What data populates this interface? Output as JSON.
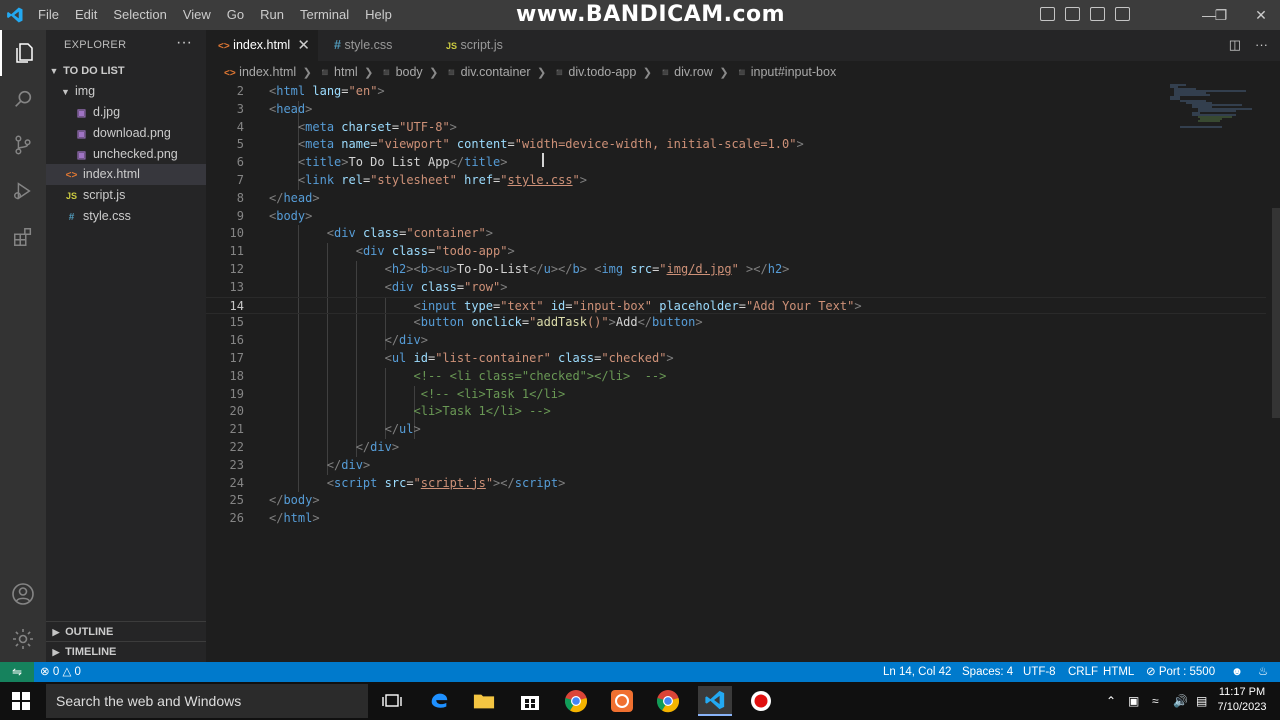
{
  "titlebar": {
    "menu": [
      "File",
      "Edit",
      "Selection",
      "View",
      "Go",
      "Run",
      "Terminal",
      "Help"
    ],
    "watermark": "www.BANDICAM.com"
  },
  "activity_bar": {
    "icons": [
      "explorer-icon",
      "search-icon",
      "source-control-icon",
      "run-debug-icon",
      "extensions-icon",
      "account-icon",
      "settings-gear-icon"
    ]
  },
  "sidebar": {
    "header": "EXPLORER",
    "more": "···",
    "root": "TO DO LIST",
    "tree": [
      {
        "label": "img",
        "kind": "folder"
      },
      {
        "label": "d.jpg",
        "kind": "image"
      },
      {
        "label": "download.png",
        "kind": "image"
      },
      {
        "label": "unchecked.png",
        "kind": "image"
      },
      {
        "label": "index.html",
        "kind": "html"
      },
      {
        "label": "script.js",
        "kind": "js"
      },
      {
        "label": "style.css",
        "kind": "css"
      }
    ],
    "outline": "OUTLINE",
    "timeline": "TIMELINE"
  },
  "tabs": [
    {
      "label": "index.html",
      "icon": "<>",
      "active": true
    },
    {
      "label": "style.css",
      "icon": "#",
      "active": false
    },
    {
      "label": "script.js",
      "icon": "JS",
      "active": false
    }
  ],
  "breadcrumb": [
    "index.html",
    "html",
    "body",
    "div.container",
    "div.todo-app",
    "div.row",
    "input#input-box"
  ],
  "editor": {
    "current_line": 14,
    "lines": [
      {
        "n": "2",
        "html": "<span class=\"br\">&lt;</span><span class=\"t\">html</span> <span class=\"a\">lang</span>=<span class=\"s\">\"en\"</span><span class=\"br\">&gt;</span>"
      },
      {
        "n": "3",
        "html": "<span class=\"br\">&lt;</span><span class=\"t\">head</span><span class=\"br\">&gt;</span>"
      },
      {
        "n": "4",
        "html": "    <span class=\"br\">&lt;</span><span class=\"t\">meta</span> <span class=\"a\">charset</span>=<span class=\"s\">\"UTF-8\"</span><span class=\"br\">&gt;</span>"
      },
      {
        "n": "5",
        "html": "    <span class=\"br\">&lt;</span><span class=\"t\">meta</span> <span class=\"a\">name</span>=<span class=\"s\">\"viewport\"</span> <span class=\"a\">content</span>=<span class=\"s\">\"width=device-width, initial-scale=1.0\"</span><span class=\"br\">&gt;</span>"
      },
      {
        "n": "6",
        "html": "    <span class=\"br\">&lt;</span><span class=\"t\">title</span><span class=\"br\">&gt;</span><span class=\"tx\">To Do List App</span><span class=\"br\">&lt;/</span><span class=\"t\">title</span><span class=\"br\">&gt;</span>"
      },
      {
        "n": "7",
        "html": "    <span class=\"br\">&lt;</span><span class=\"t\">link</span> <span class=\"a\">rel</span>=<span class=\"s\">\"stylesheet\"</span> <span class=\"a\">href</span>=<span class=\"s\">\"<u>style.css</u>\"</span><span class=\"br\">&gt;</span>"
      },
      {
        "n": "8",
        "html": "<span class=\"br\">&lt;/</span><span class=\"t\">head</span><span class=\"br\">&gt;</span>"
      },
      {
        "n": "9",
        "html": "<span class=\"br\">&lt;</span><span class=\"t\">body</span><span class=\"br\">&gt;</span>"
      },
      {
        "n": "10",
        "html": "        <span class=\"br\">&lt;</span><span class=\"t\">div</span> <span class=\"a\">class</span>=<span class=\"s\">\"container\"</span><span class=\"br\">&gt;</span>"
      },
      {
        "n": "11",
        "html": "            <span class=\"br\">&lt;</span><span class=\"t\">div</span> <span class=\"a\">class</span>=<span class=\"s\">\"todo-app\"</span><span class=\"br\">&gt;</span>"
      },
      {
        "n": "12",
        "html": "                <span class=\"br\">&lt;</span><span class=\"t\">h2</span><span class=\"br\">&gt;&lt;</span><span class=\"t\">b</span><span class=\"br\">&gt;&lt;</span><span class=\"t\">u</span><span class=\"br\">&gt;</span><span class=\"tx\">To-Do-List</span><span class=\"br\">&lt;/</span><span class=\"t\">u</span><span class=\"br\">&gt;&lt;/</span><span class=\"t\">b</span><span class=\"br\">&gt;</span> <span class=\"br\">&lt;</span><span class=\"t\">img</span> <span class=\"a\">src</span>=<span class=\"s\">\"<u>img/d.jpg</u>\"</span> <span class=\"br\">&gt;&lt;/</span><span class=\"t\">h2</span><span class=\"br\">&gt;</span>"
      },
      {
        "n": "13",
        "html": "                <span class=\"br\">&lt;</span><span class=\"t\">div</span> <span class=\"a\">class</span>=<span class=\"s\">\"row\"</span><span class=\"br\">&gt;</span>"
      },
      {
        "n": "14",
        "html": "                    <span class=\"br\">&lt;</span><span class=\"t\">input</span> <span class=\"a\">type</span>=<span class=\"s\">\"text\"</span> <span class=\"a\">id</span>=<span class=\"s\">\"input-box\"</span> <span class=\"a\">placeholder</span>=<span class=\"s\">\"Add Your Text\"</span><span class=\"br\">&gt;</span>"
      },
      {
        "n": "15",
        "html": "                    <span class=\"br\">&lt;</span><span class=\"t\">button</span> <span class=\"a\">onclick</span>=<span class=\"s\">\"</span><span class=\"f\">addTask</span><span class=\"s\">()\"</span><span class=\"br\">&gt;</span><span class=\"tx\">Add</span><span class=\"br\">&lt;/</span><span class=\"t\">button</span><span class=\"br\">&gt;</span>"
      },
      {
        "n": "16",
        "html": "                <span class=\"br\">&lt;/</span><span class=\"t\">div</span><span class=\"br\">&gt;</span>"
      },
      {
        "n": "17",
        "html": "                <span class=\"br\">&lt;</span><span class=\"t\">ul</span> <span class=\"a\">id</span>=<span class=\"s\">\"list-container\"</span> <span class=\"a\">class</span>=<span class=\"s\">\"checked\"</span><span class=\"br\">&gt;</span>"
      },
      {
        "n": "18",
        "html": "                    <span class=\"c\">&lt;!-- &lt;li class=\"checked\"&gt;&lt;/li&gt;  --&gt;</span>"
      },
      {
        "n": "19",
        "html": "                     <span class=\"c\">&lt;!-- &lt;li&gt;Task 1&lt;/li&gt;</span>"
      },
      {
        "n": "20",
        "html": "                    <span class=\"c\">&lt;li&gt;Task 1&lt;/li&gt; --&gt;</span>"
      },
      {
        "n": "21",
        "html": "                <span class=\"br\">&lt;/</span><span class=\"t\">ul</span><span class=\"br\">&gt;</span>"
      },
      {
        "n": "22",
        "html": "            <span class=\"br\">&lt;/</span><span class=\"t\">div</span><span class=\"br\">&gt;</span>"
      },
      {
        "n": "23",
        "html": "        <span class=\"br\">&lt;/</span><span class=\"t\">div</span><span class=\"br\">&gt;</span>"
      },
      {
        "n": "24",
        "html": "        <span class=\"br\">&lt;</span><span class=\"t\">script</span> <span class=\"a\">src</span>=<span class=\"s\">\"<u>script.js</u>\"</span><span class=\"br\">&gt;&lt;/</span><span class=\"t\">script</span><span class=\"br\">&gt;</span>"
      },
      {
        "n": "25",
        "html": "<span class=\"br\">&lt;/</span><span class=\"t\">body</span><span class=\"br\">&gt;</span>"
      },
      {
        "n": "26",
        "html": "<span class=\"br\">&lt;/</span><span class=\"t\">html</span><span class=\"br\">&gt;</span>"
      }
    ]
  },
  "statusbar": {
    "errors": "0",
    "warnings": "0",
    "position": "Ln 14, Col 42",
    "spaces": "Spaces: 4",
    "encoding": "UTF-8",
    "eol": "CRLF",
    "language": "HTML",
    "port": "Port : 5500"
  },
  "taskbar": {
    "search_placeholder": "Search the web and Windows",
    "apps": [
      "task-view-icon",
      "edge-icon",
      "file-explorer-icon",
      "store-icon",
      "chrome-icon",
      "bandicam-icon",
      "chrome-icon",
      "vscode-icon",
      "record-icon"
    ],
    "time": "11:17 PM",
    "date": "7/10/2023"
  },
  "colors": {
    "accent": "#007acc",
    "editor_bg": "#1e1e1e",
    "sidebar_bg": "#252526",
    "activity_bg": "#333333"
  }
}
